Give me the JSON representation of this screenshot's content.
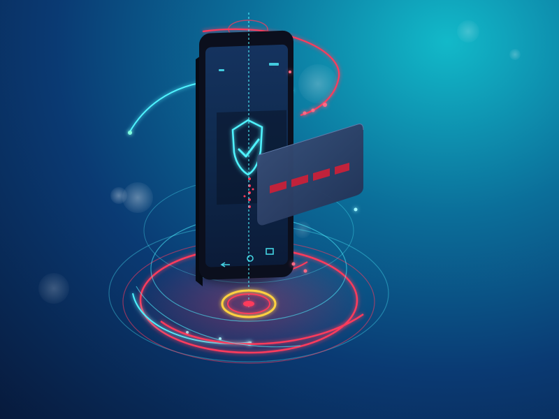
{
  "illustration": {
    "subject": "mobile-payment-security",
    "icons": [
      "smartphone-icon",
      "shield-check-icon",
      "credit-card-icon",
      "fingerprint-target-icon"
    ],
    "colors": {
      "background_light": "#12b9c9",
      "background_mid": "#0b6f9a",
      "background_dark": "#071a3c",
      "glow_cyan": "#4ff3ff",
      "glow_red": "#ff3a5c",
      "target_yellow": "#ffd23f",
      "card_body": "#2a3f66",
      "card_dash": "#c0223b",
      "phone_frame": "#0b0f1d"
    },
    "card_dash_count": 4,
    "nav_icons": [
      "back-icon",
      "home-icon",
      "recent-apps-icon"
    ]
  }
}
